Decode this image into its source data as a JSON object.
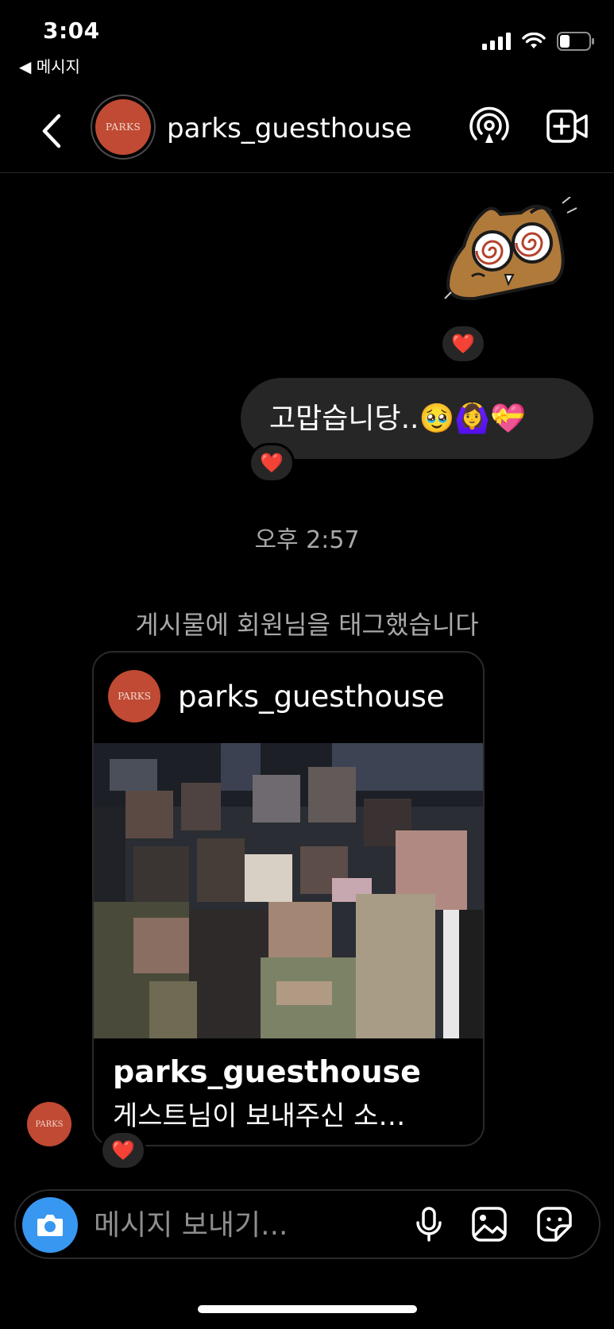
{
  "status_bar": {
    "time": "3:04",
    "back_app": "◀ 메시지"
  },
  "header": {
    "avatar_text": "PARKS",
    "username": "parks_guesthouse",
    "icons": [
      "broadcast-icon",
      "video-call-icon"
    ]
  },
  "messages": {
    "sticker_reaction": "❤️",
    "outgoing_text": "고맙습니당..🥹🙆‍♀️💝",
    "outgoing_reaction": "❤️",
    "timestamp": "오후 2:57",
    "system_text": "게시물에 회원님을 태그했습니다",
    "post": {
      "avatar_text": "PARKS",
      "username": "parks_guesthouse",
      "caption_user": "parks_guesthouse",
      "caption_text": "게스트님이 보내주신 소…",
      "reaction": "❤️"
    },
    "sender_avatar_text": "PARKS"
  },
  "composer": {
    "placeholder": "메시지 보내기..."
  },
  "colors": {
    "background": "#000000",
    "bubble": "#262626",
    "accent_blue": "#3897f0",
    "brand_red": "#c04a33",
    "muted_text": "#a8a8a8"
  }
}
